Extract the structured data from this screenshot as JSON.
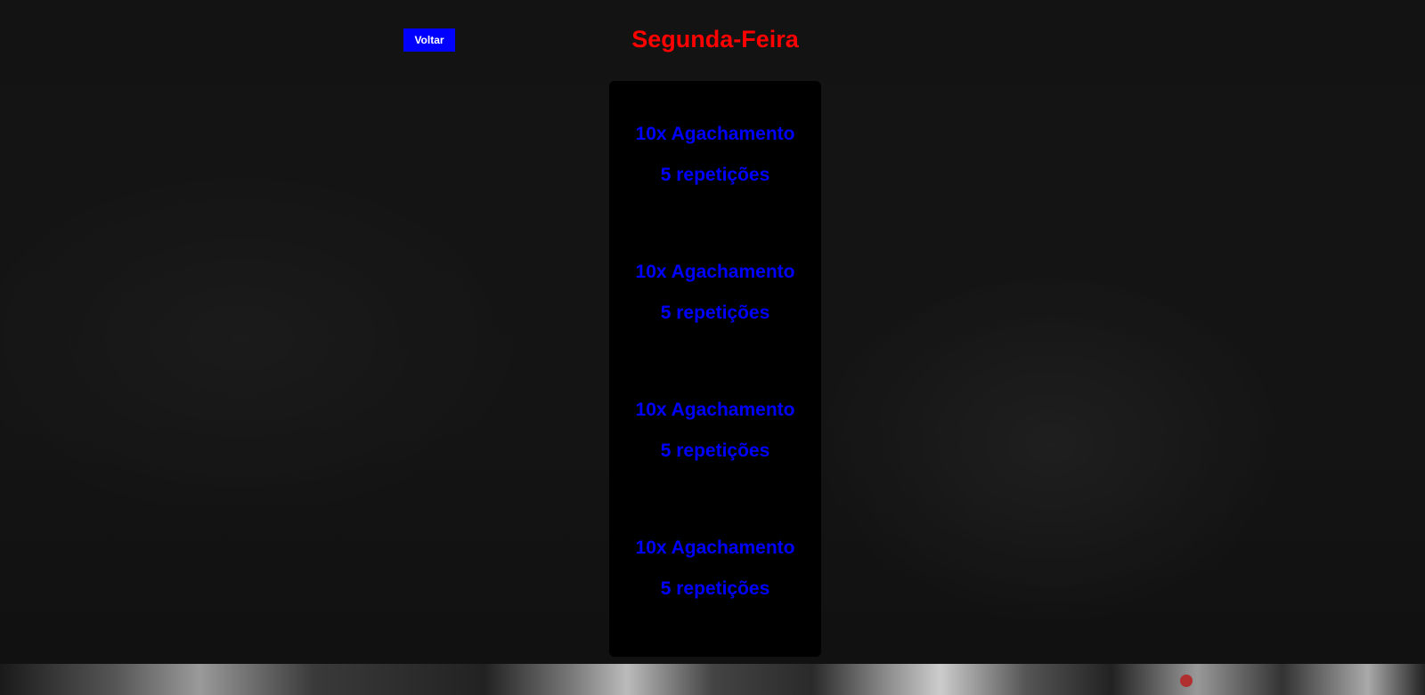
{
  "header": {
    "back_label": "Voltar",
    "title": "Segunda-Feira"
  },
  "exercises": [
    {
      "name": "10x Agachamento",
      "reps": "5 repetições"
    },
    {
      "name": "10x Agachamento",
      "reps": "5 repetições"
    },
    {
      "name": "10x Agachamento",
      "reps": "5 repetições"
    },
    {
      "name": "10x Agachamento",
      "reps": "5 repetições"
    }
  ],
  "colors": {
    "title": "#ff0000",
    "button": "#0000ff",
    "exercise_text": "#0000ff",
    "panel": "#000000"
  }
}
